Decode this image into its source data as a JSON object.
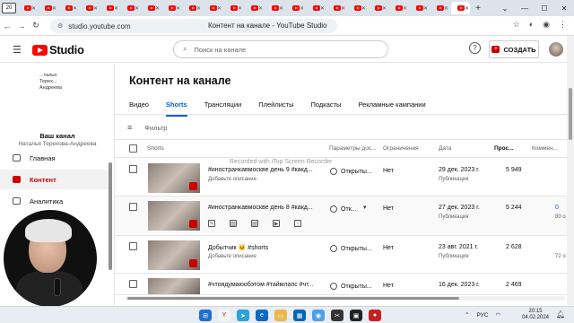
{
  "browser": {
    "tab_counter": "20",
    "url": "studio.youtube.com",
    "page_title": "Контент на канале - YouTube Studio"
  },
  "header": {
    "logo_text": "Studio",
    "search_placeholder": "Поиск на канале",
    "create_label": "СОЗДАТЬ",
    "help_symbol": "?"
  },
  "sidebar": {
    "channel_mini_name": "...талья Терех... Андреева",
    "channel_title": "Ваш канал",
    "channel_name": "Наталья Терехова-Андреева",
    "items": [
      {
        "label": "Главная"
      },
      {
        "label": "Контент"
      },
      {
        "label": "Аналитика"
      }
    ]
  },
  "main": {
    "title": "Контент на канале",
    "tabs": [
      {
        "label": "Видео"
      },
      {
        "label": "Shorts"
      },
      {
        "label": "Трансляции"
      },
      {
        "label": "Плейлисты"
      },
      {
        "label": "Подкасты"
      },
      {
        "label": "Рекламные кампании"
      }
    ],
    "filter_label": "Фильтр",
    "columns": {
      "shorts": "Shorts",
      "visibility": "Параметры дос...",
      "restrictions": "Ограничения",
      "date": "Дата",
      "views": "Прос...",
      "comments": "Коммен..."
    },
    "rows": [
      {
        "title": "#иностранкавмоскве день 9 #какд...",
        "desc": "Добавьте описание",
        "visibility": "Открыты...",
        "restrictions": "Нет",
        "date": "29 дек. 2023 г.",
        "status": "Публикация",
        "views": "5 949",
        "comments": "",
        "comments_sub": ""
      },
      {
        "title": "#иностранкавмоскве день 8 #какд...",
        "desc": "",
        "visibility": "Отк...",
        "restrictions": "Нет",
        "date": "27 дек. 2023 г.",
        "status": "Публикация",
        "views": "5 244",
        "comments": "0",
        "comments_sub": "80 о"
      },
      {
        "title": "Добытчик 🐱 #shorts",
        "desc": "Добавьте описание",
        "visibility": "Открыты...",
        "restrictions": "Нет",
        "date": "23 авг. 2021 г.",
        "status": "Публикация",
        "views": "2 628",
        "comments": "",
        "comments_sub": "72 о"
      },
      {
        "title": "#чтоядумаюобэтом #таймлапс #чт...",
        "desc": "",
        "visibility": "Открыты...",
        "restrictions": "Нет",
        "date": "16 дек. 2023 г.",
        "status": "",
        "views": "2 469",
        "comments": "",
        "comments_sub": ""
      }
    ]
  },
  "overlay": {
    "recorder_text": "Recorded with iTop Screen Recorder"
  },
  "taskbar": {
    "language": "РУС",
    "time": "20:15",
    "date": "04.02.2024"
  },
  "colors": {
    "accent_blue": "#065fd4",
    "youtube_red": "#ff0000",
    "active_red": "#cc0000"
  }
}
